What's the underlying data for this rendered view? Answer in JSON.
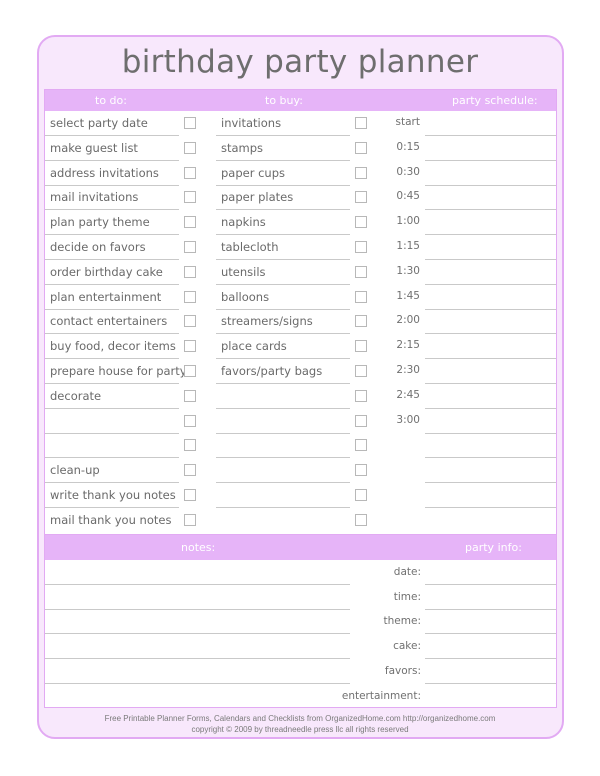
{
  "title": "birthday party planner",
  "colors": {
    "accent": "#e6b4f8",
    "card_bg": "#f8e8fc",
    "border": "#e2aaf3"
  },
  "headers": {
    "todo": "to do:",
    "tobuy": "to buy:",
    "schedule": "party schedule:",
    "notes": "notes:",
    "info": "party info:"
  },
  "todo": [
    "select party date",
    "make guest list",
    "address invitations",
    "mail invitations",
    "plan party theme",
    "decide on favors",
    "order birthday cake",
    "plan entertainment",
    "contact entertainers",
    "buy food, decor items",
    "prepare house for party",
    "decorate",
    "",
    "",
    "clean-up",
    "write thank you notes",
    "mail thank you notes"
  ],
  "tobuy": [
    "invitations",
    "stamps",
    "paper cups",
    "paper plates",
    "napkins",
    "tablecloth",
    "utensils",
    "balloons",
    "streamers/signs",
    "place cards",
    "favors/party bags",
    "",
    "",
    "",
    "",
    "",
    ""
  ],
  "schedule": [
    "start",
    "0:15",
    "0:30",
    "0:45",
    "1:00",
    "1:15",
    "1:30",
    "1:45",
    "2:00",
    "2:15",
    "2:30",
    "2:45",
    "3:00",
    "",
    "",
    "",
    ""
  ],
  "party_info": [
    "date:",
    "time:",
    "theme:",
    "cake:",
    "favors:",
    "entertainment:"
  ],
  "footer": {
    "line1": "Free Printable Planner Forms, Calendars and Checklists from OrganizedHome.com      http://organizedhome.com",
    "line2": "copyright © 2009 by threadneedle press llc      all rights reserved"
  }
}
